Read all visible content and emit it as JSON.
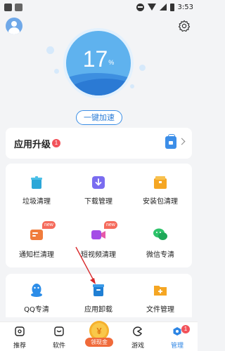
{
  "status_bar": {
    "time": "3:53"
  },
  "hero": {
    "percent_value": "17",
    "percent_sign": "%",
    "boost_button": "一键加速",
    "circle_color": "#5fb2ee",
    "accent": "#3b8ee6"
  },
  "upgrade": {
    "title": "应用升级",
    "badge": "1"
  },
  "tools_row1": [
    {
      "label": "垃圾清理",
      "icon": "trash-clean-icon"
    },
    {
      "label": "下载管理",
      "icon": "download-icon"
    },
    {
      "label": "安装包清理",
      "icon": "package-clean-icon"
    }
  ],
  "tools_row2": [
    {
      "label": "通知栏清理",
      "icon": "notification-clean-icon",
      "tag": "new"
    },
    {
      "label": "短视频清理",
      "icon": "video-clean-icon",
      "tag": "new"
    },
    {
      "label": "微信专清",
      "icon": "wechat-icon"
    }
  ],
  "tools_row3": [
    {
      "label": "QQ专清",
      "icon": "qq-icon"
    },
    {
      "label": "应用卸载",
      "icon": "uninstall-icon"
    },
    {
      "label": "文件管理",
      "icon": "folder-icon"
    }
  ],
  "tabbar": {
    "items": [
      {
        "label": "推荐",
        "icon": "recommend-icon"
      },
      {
        "label": "软件",
        "icon": "software-icon"
      },
      {
        "label": "游戏",
        "icon": "game-icon"
      },
      {
        "label": "管理",
        "icon": "manage-icon",
        "badge": "1",
        "active": true
      }
    ],
    "reward_label": "领现金",
    "reward_symbol": "¥"
  }
}
